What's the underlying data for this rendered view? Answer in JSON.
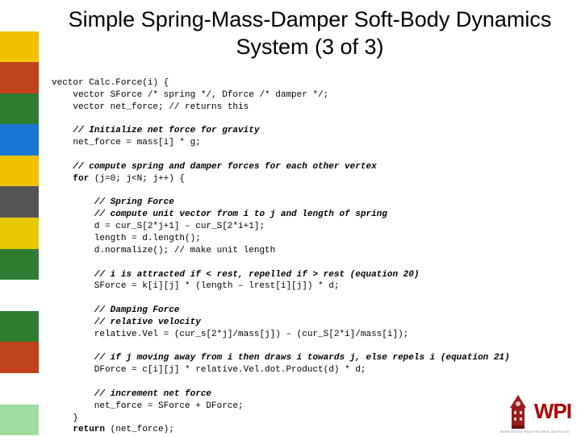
{
  "sidebar_colors": [
    "#ffffff",
    "#f2c200",
    "#c0431b",
    "#2e7d32",
    "#1976d2",
    "#f2c200",
    "#555555",
    "#e7c900",
    "#2e7d32",
    "#ffffff",
    "#2e7d32",
    "#c0431b",
    "#ffffff",
    "#9fdc9f"
  ],
  "title": "Simple Spring-Mass-Damper Soft-Body Dynamics System (3 of 3)",
  "code": {
    "l1": "vector Calc.Force(i) {",
    "l2": "    vector SForce /* spring */, Dforce /* damper */;",
    "l3": "    vector net_force; // returns this",
    "l4": "",
    "c1": "    // Initialize net force for gravity",
    "l5": "    net_force = mass[i] * g;",
    "l6": "",
    "c2": "    // compute spring and damper forces for each other vertex",
    "l7p": "    ",
    "l7f": "for",
    "l7r": " (j=0; j<N; j++) {",
    "l8": "",
    "c3a": "        // Spring Force",
    "c3b": "        // compute unit vector from i to j and length of spring",
    "l9": "        d = cur_S[2*j+1] – cur_S[2*i+1];",
    "l10": "        length = d.length();",
    "l11": "        d.normalize(); // make unit length",
    "l12": "",
    "c4": "        // i is attracted if < rest, repelled if > rest (equation 20)",
    "l13": "        SForce = k[i][j] * (length – lrest[i][j]) * d;",
    "l14": "",
    "c5a": "        // Damping Force",
    "c5b": "        // relative velocity",
    "l15": "        relative.Vel = (cur_s[2*j]/mass[j]) – (cur_S[2*i]/mass[i]);",
    "l16": "",
    "c6": "        // if j moving away from i then draws i towards j, else repels i (equation 21)",
    "l17": "        DForce = c[i][j] * relative.Vel.dot.Product(d) * d;",
    "l18": "",
    "c7": "        // increment net force",
    "l19": "        net_force = SForce + DForce;",
    "l20": "    }",
    "l21p": "    ",
    "l21r": "return",
    "l21e": " (net_force);"
  },
  "logo": {
    "text": "WPI",
    "sub": "WORCESTER POLYTECHNIC INSTITUTE"
  }
}
